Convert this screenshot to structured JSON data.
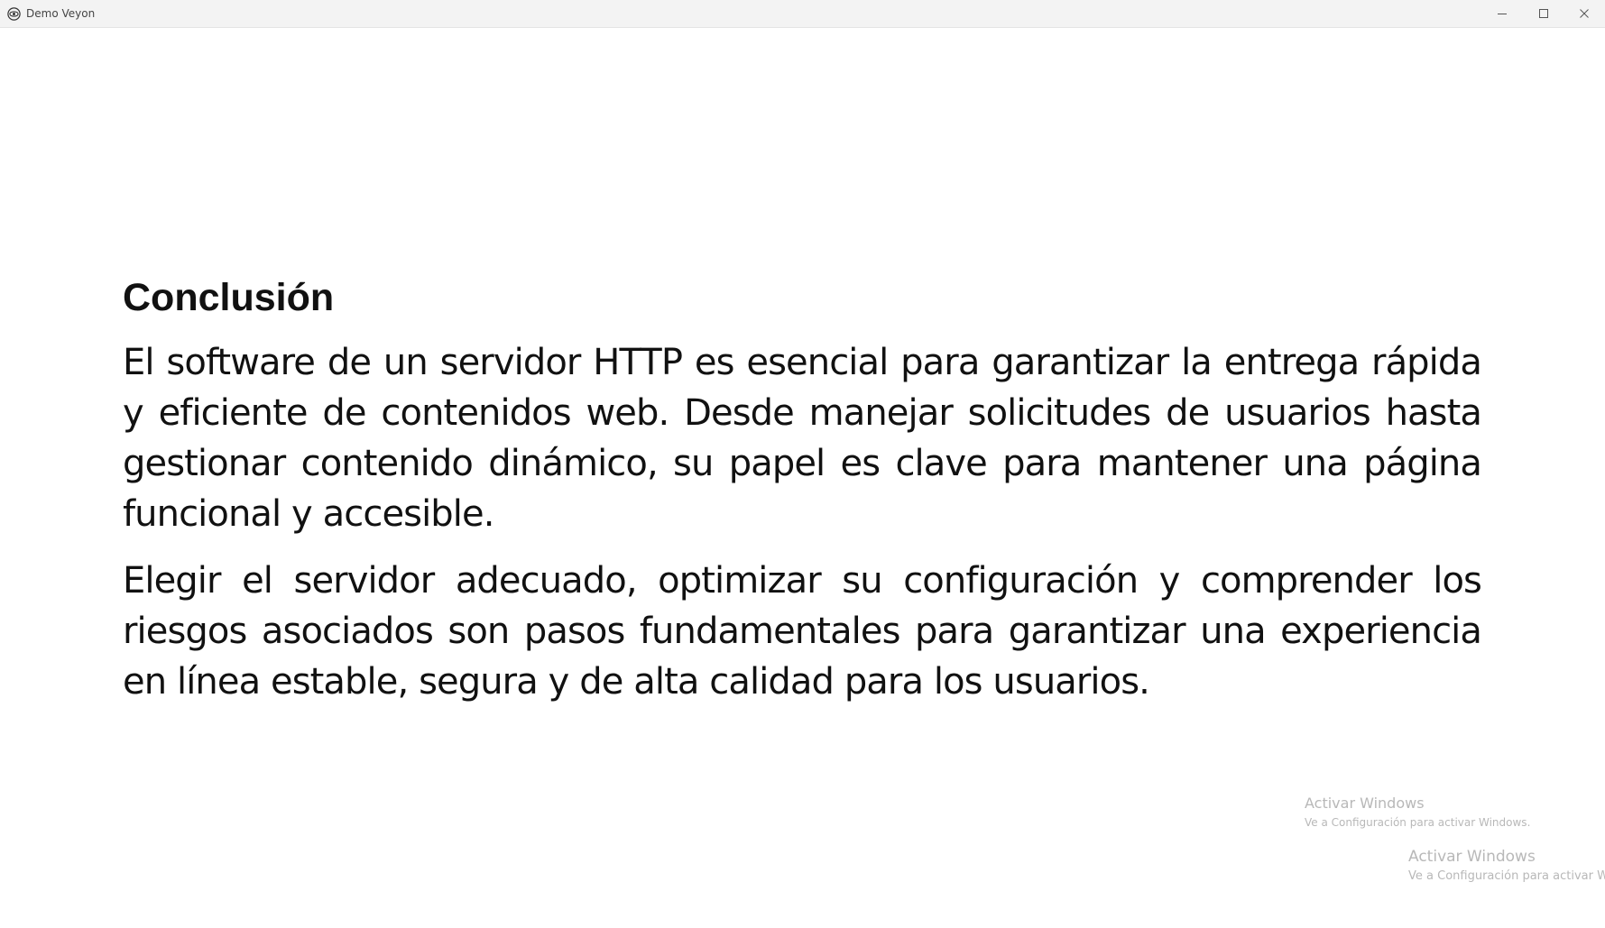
{
  "window": {
    "title": "Demo Veyon",
    "app_icon": "veyon-eye-icon",
    "controls": {
      "minimize_icon": "minimize-icon",
      "maximize_icon": "maximize-icon",
      "close_icon": "close-icon"
    }
  },
  "slide": {
    "title": "Conclusión",
    "paragraphs": [
      "El software de un servidor HTTP es esencial para garantizar la entrega rápida y eficiente de contenidos web. Desde manejar solicitudes de usuarios hasta gestionar contenido dinámico, su papel es clave para mantener una página funcional y accesible.",
      "Elegir el servidor adecuado, optimizar su configuración y comprender los riesgos asociados son pasos fundamentales para garantizar una experiencia en línea estable, segura y de alta calidad para los usuarios."
    ]
  },
  "watermarks": [
    {
      "title": "Activar Windows",
      "subtitle": "Ve a Configuración para activar Windows."
    },
    {
      "title": "Activar Windows",
      "subtitle": "Ve a Configuración para activar W"
    }
  ]
}
